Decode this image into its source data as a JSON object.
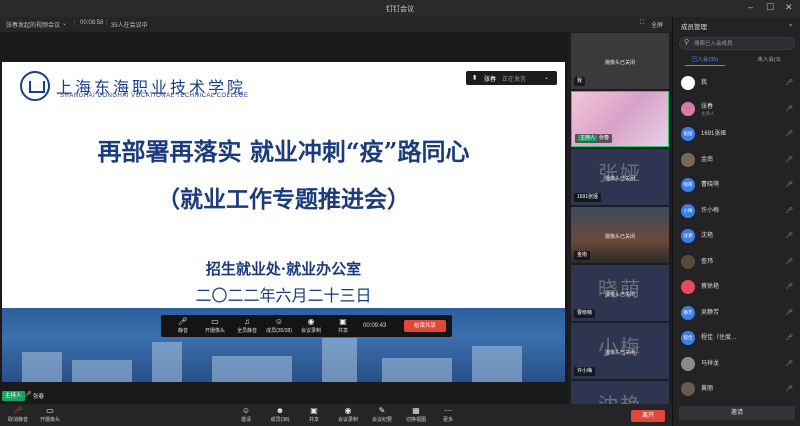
{
  "window": {
    "title": "钉钉会议"
  },
  "infobar": {
    "meeting_name": "张春发起的视频会议",
    "duration": "00:08:58",
    "participants_status": "35人在会议中",
    "fullscreen_label": "全屏"
  },
  "slide": {
    "logo_text": "上海东海职业技术学院",
    "logo_sub": "SHANGHAI DONGHAI VOCATIONAL TECHNICAL COLLEGE",
    "title": "再部署再落实   就业冲刺“疫”路同心",
    "subtitle": "（就业工作专题推进会）",
    "department": "招生就业处·就业办公室",
    "date": "二〇二二年六月二十三日"
  },
  "speaking_indicator": {
    "name": "张春",
    "status": "正在发言"
  },
  "share_bar": {
    "items": [
      "静音",
      "开摄像头",
      "全员静音",
      "成员(35/38)",
      "会议录制",
      "共享"
    ],
    "timer": "00:09:43",
    "stop_label": "结束共享"
  },
  "active_speaker": {
    "role": "主持人",
    "name": "张春"
  },
  "video_tiles": [
    {
      "name": "我",
      "ghost": "",
      "cam_off": "摄像头已关闭",
      "host": false
    },
    {
      "name": "张春",
      "ghost": "",
      "cam_off": "",
      "host": true,
      "role": "主持人"
    },
    {
      "name": "1691张娅",
      "ghost": "张娅",
      "cam_off": "摄像头已关闭",
      "host": false
    },
    {
      "name": "金南",
      "ghost": "",
      "cam_off": "摄像头已关闭",
      "host": false
    },
    {
      "name": "曹晓萌",
      "ghost": "晓萌",
      "cam_off": "摄像头已关闭",
      "host": false
    },
    {
      "name": "许小梅",
      "ghost": "小梅",
      "cam_off": "摄像头已关闭",
      "host": false
    },
    {
      "name": "",
      "ghost": "沈艳",
      "cam_off": "",
      "host": false
    }
  ],
  "panel": {
    "title": "成员管理",
    "search_placeholder": "搜索已入会成员",
    "tab_joined": "已入会(35)",
    "tab_not_joined": "未入会(3)",
    "invite_label": "邀请"
  },
  "members": [
    {
      "avatar": "",
      "name": "我",
      "sub": "",
      "color": "#ffffff"
    },
    {
      "avatar": "",
      "name": "张春",
      "sub": "主持人",
      "color": "#d97aa8"
    },
    {
      "avatar": "张娅",
      "name": "1691张娅",
      "sub": "",
      "color": "#3e7ee8"
    },
    {
      "avatar": "",
      "name": "金南",
      "sub": "",
      "color": "#7a6a55"
    },
    {
      "avatar": "晓萌",
      "name": "曹晓萌",
      "sub": "",
      "color": "#3e7ee8"
    },
    {
      "avatar": "小梅",
      "name": "许小梅",
      "sub": "",
      "color": "#3e7ee8"
    },
    {
      "avatar": "沈艳",
      "name": "沈艳",
      "sub": "",
      "color": "#3e7ee8"
    },
    {
      "avatar": "",
      "name": "查玮",
      "sub": "",
      "color": "#5a4a3a"
    },
    {
      "avatar": "",
      "name": "蔡徐艳",
      "sub": "",
      "color": "#e84a5f"
    },
    {
      "avatar": "静芳",
      "name": "吴静芳",
      "sub": "",
      "color": "#3e7ee8"
    },
    {
      "avatar": "程佳",
      "name": "程佳（住度...",
      "sub": "",
      "color": "#3e7ee8"
    },
    {
      "avatar": "",
      "name": "马祥龙",
      "sub": "",
      "color": "#8a8a8a"
    },
    {
      "avatar": "",
      "name": "黄丽",
      "sub": "",
      "color": "#6a5a4a"
    }
  ],
  "toolbar": {
    "items": [
      "取消静音",
      "开摄像头",
      "邀请",
      "成员(38)",
      "共享",
      "会议录制",
      "会议纪要",
      "切换视图",
      "更多"
    ],
    "leave_label": "离开"
  }
}
